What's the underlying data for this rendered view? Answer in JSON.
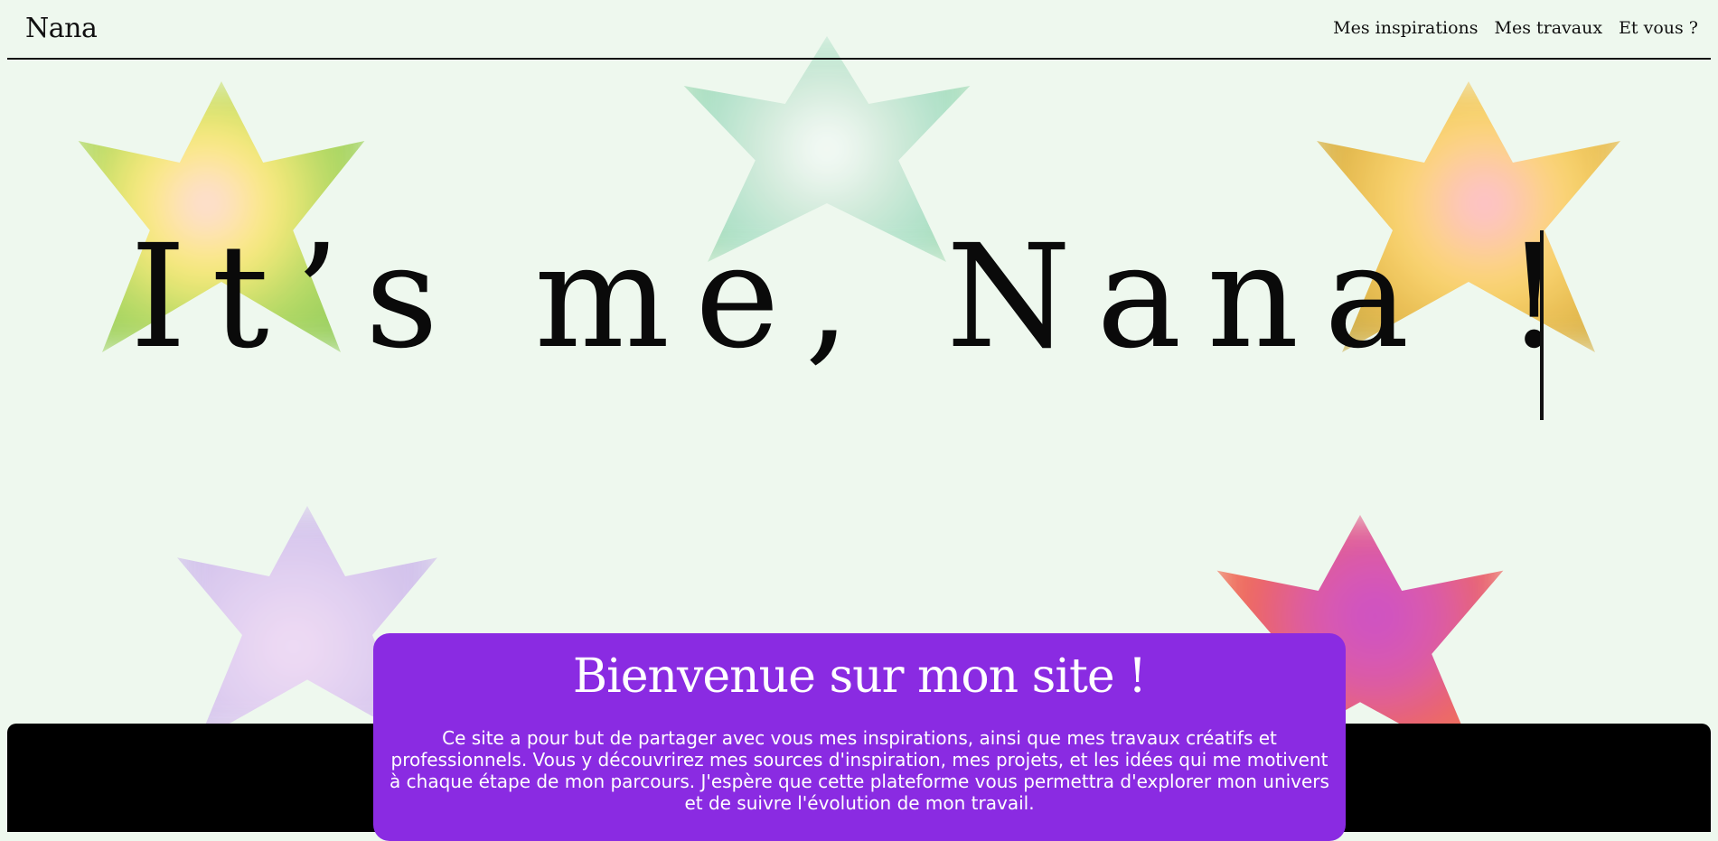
{
  "header": {
    "logo": "Nana",
    "nav": [
      "Mes inspirations",
      "Mes travaux",
      "Et vous ?"
    ]
  },
  "hero": {
    "title": "It’s me, Nana !"
  },
  "welcome": {
    "title": "Bienvenue sur mon site !",
    "text": "Ce site a pour but de partager avec vous mes inspirations, ainsi que mes travaux créatifs et professionnels. Vous y découvrirez mes sources d'inspiration, mes projets, et les idées qui me motivent à chaque étape de mon parcours. J'espère que cette plateforme vous permettra d'explorer mon univers et de suivre l'évolution de mon travail."
  },
  "colors": {
    "background": "#eef8ee",
    "card": "#8a2be2",
    "text": "#0a0a0a"
  }
}
